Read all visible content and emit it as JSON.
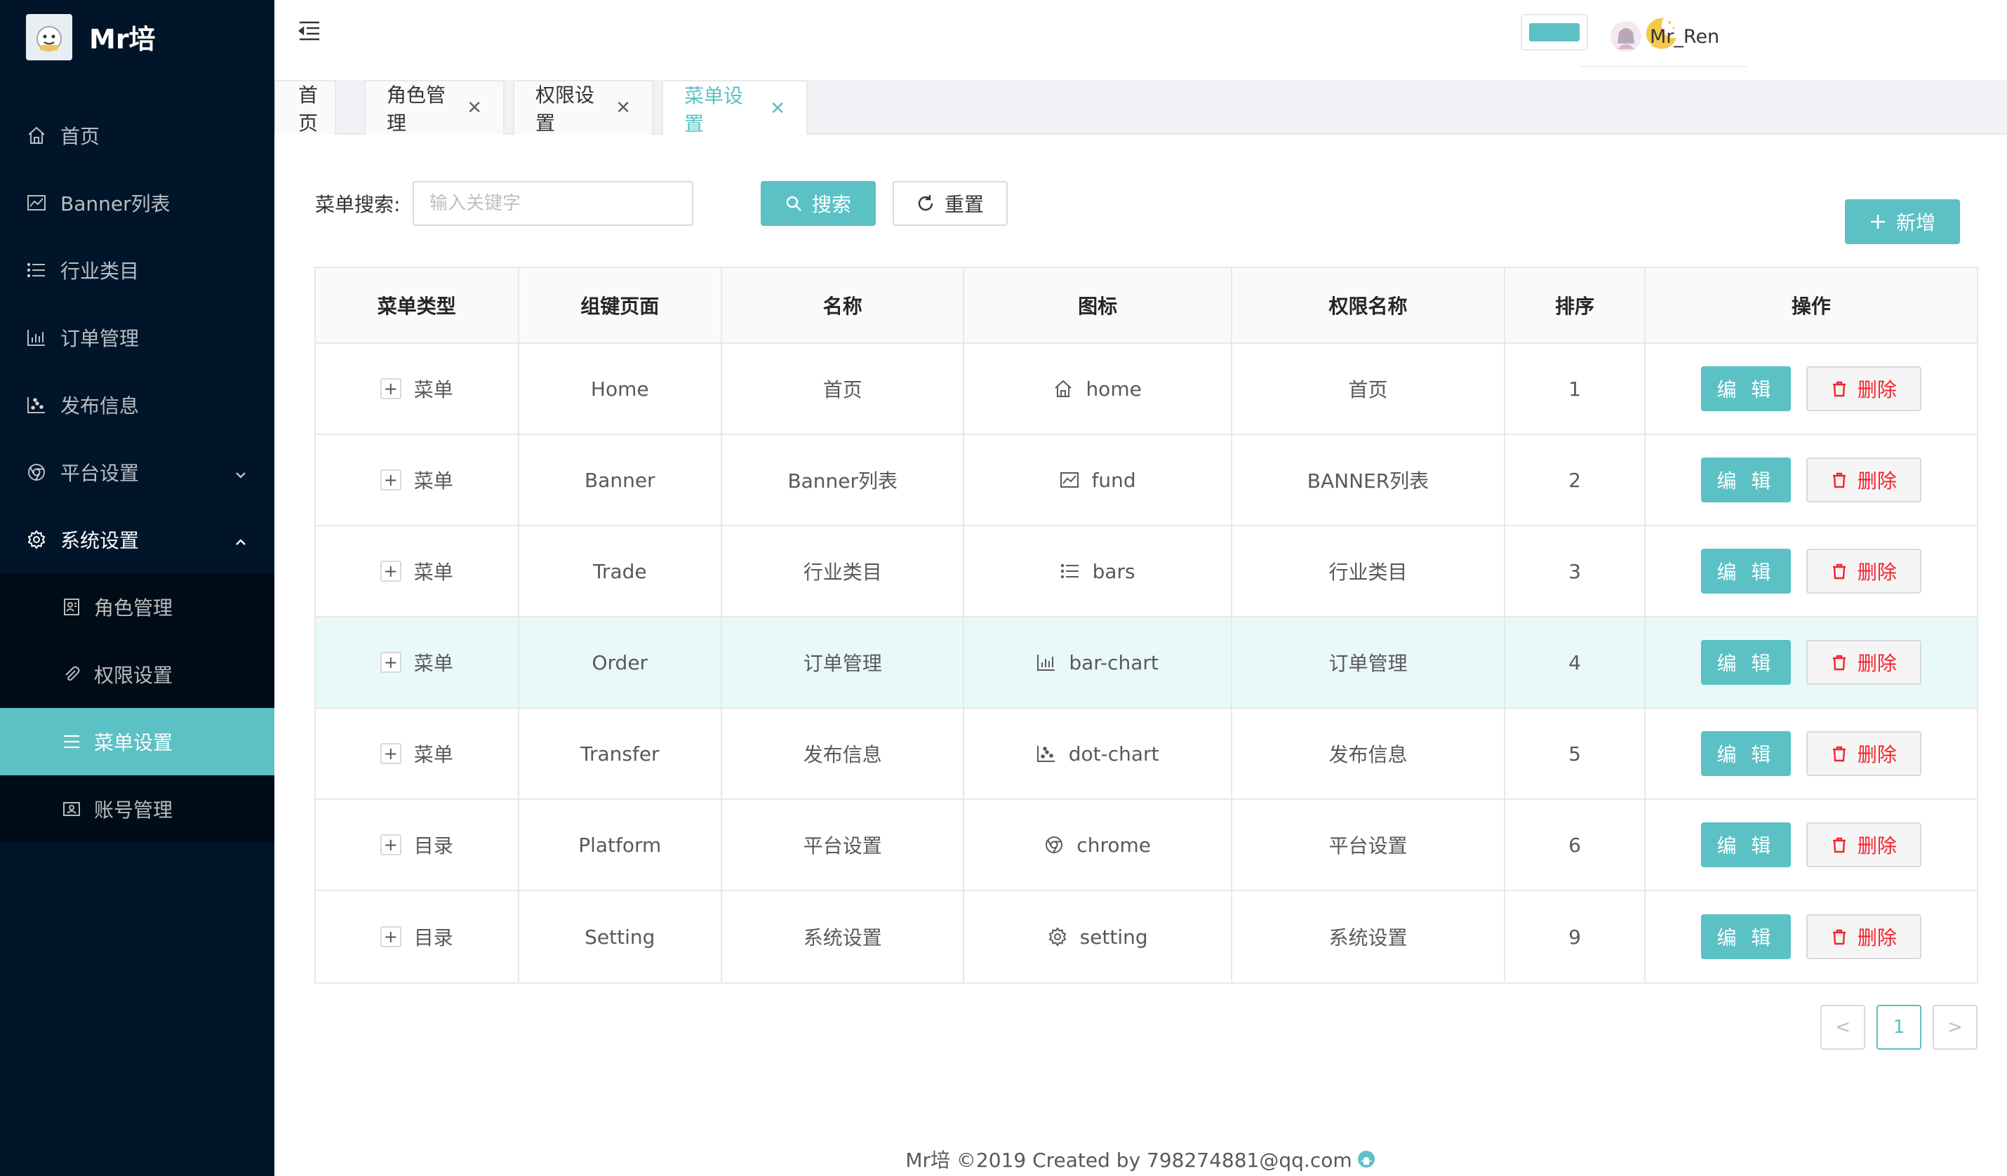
{
  "app": {
    "title": "Mr培"
  },
  "sidebar": {
    "items": [
      {
        "label": "首页",
        "icon": "home-icon"
      },
      {
        "label": "Banner列表",
        "icon": "fund-icon"
      },
      {
        "label": "行业类目",
        "icon": "bars-icon"
      },
      {
        "label": "订单管理",
        "icon": "bar-chart-icon"
      },
      {
        "label": "发布信息",
        "icon": "dot-chart-icon"
      },
      {
        "label": "平台设置",
        "icon": "chrome-icon"
      },
      {
        "label": "系统设置",
        "icon": "setting-icon"
      }
    ],
    "sub_items": [
      {
        "label": "角色管理",
        "icon": "profile-icon"
      },
      {
        "label": "权限设置",
        "icon": "paper-clip-icon"
      },
      {
        "label": "菜单设置",
        "icon": "menu-icon"
      },
      {
        "label": "账号管理",
        "icon": "idcard-icon"
      }
    ]
  },
  "header": {
    "user_name": "Mr_Ren",
    "theme_color": "#5bc1c5"
  },
  "tabs": [
    {
      "label": "首页"
    },
    {
      "label": "角色管理"
    },
    {
      "label": "权限设置"
    },
    {
      "label": "菜单设置"
    }
  ],
  "search": {
    "label": "菜单搜索:",
    "placeholder": "输入关键字",
    "search_label": "搜索",
    "reset_label": "重置",
    "add_label": "新增"
  },
  "table": {
    "columns": [
      "菜单类型",
      "组键页面",
      "名称",
      "图标",
      "权限名称",
      "排序",
      "操作"
    ],
    "edit_label": "编 辑",
    "delete_label": "删除",
    "rows": [
      {
        "type": "菜单",
        "page": "Home",
        "name": "首页",
        "icon_name": "home",
        "perm": "首页",
        "order": "1"
      },
      {
        "type": "菜单",
        "page": "Banner",
        "name": "Banner列表",
        "icon_name": "fund",
        "perm": "BANNER列表",
        "order": "2"
      },
      {
        "type": "菜单",
        "page": "Trade",
        "name": "行业类目",
        "icon_name": "bars",
        "perm": "行业类目",
        "order": "3"
      },
      {
        "type": "菜单",
        "page": "Order",
        "name": "订单管理",
        "icon_name": "bar-chart",
        "perm": "订单管理",
        "order": "4"
      },
      {
        "type": "菜单",
        "page": "Transfer",
        "name": "发布信息",
        "icon_name": "dot-chart",
        "perm": "发布信息",
        "order": "5"
      },
      {
        "type": "目录",
        "page": "Platform",
        "name": "平台设置",
        "icon_name": "chrome",
        "perm": "平台设置",
        "order": "6"
      },
      {
        "type": "目录",
        "page": "Setting",
        "name": "系统设置",
        "icon_name": "setting",
        "perm": "系统设置",
        "order": "9"
      }
    ]
  },
  "pagination": {
    "current": "1",
    "prev": "<",
    "next": ">"
  },
  "footer": {
    "text": "Mr培 ©2019 Created by 798274881@qq.com"
  }
}
